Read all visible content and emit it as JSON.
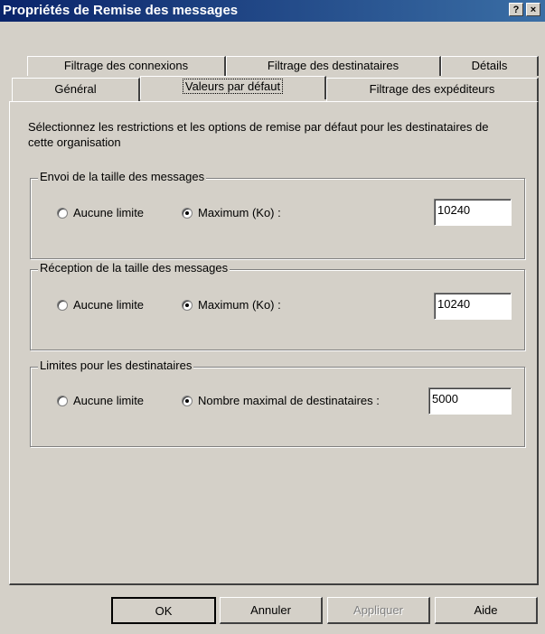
{
  "window": {
    "title": "Propriétés de Remise des messages",
    "help_button": "?",
    "close_button": "×"
  },
  "tabs_row1": [
    {
      "label": "Filtrage des connexions"
    },
    {
      "label": "Filtrage des destinataires"
    },
    {
      "label": "Détails"
    }
  ],
  "tabs_row2": [
    {
      "label": "Général"
    },
    {
      "label": "Valeurs par défaut",
      "active": true
    },
    {
      "label": "Filtrage des expéditeurs"
    }
  ],
  "description": "Sélectionnez les restrictions et les options de remise par défaut pour les destinataires de cette organisation",
  "groups": {
    "send": {
      "title": "Envoi de la taille des messages",
      "opt_none": "Aucune limite",
      "opt_max": "Maximum (Ko) :",
      "value": "10240",
      "selected": "max"
    },
    "receive": {
      "title": "Réception de la taille des messages",
      "opt_none": "Aucune limite",
      "opt_max": "Maximum (Ko) :",
      "value": "10240",
      "selected": "max"
    },
    "recipients": {
      "title": "Limites pour les destinataires",
      "opt_none": "Aucune limite",
      "opt_max": "Nombre maximal de destinataires :",
      "value": "5000",
      "selected": "max"
    }
  },
  "buttons": {
    "ok": "OK",
    "cancel": "Annuler",
    "apply": "Appliquer",
    "help": "Aide"
  }
}
